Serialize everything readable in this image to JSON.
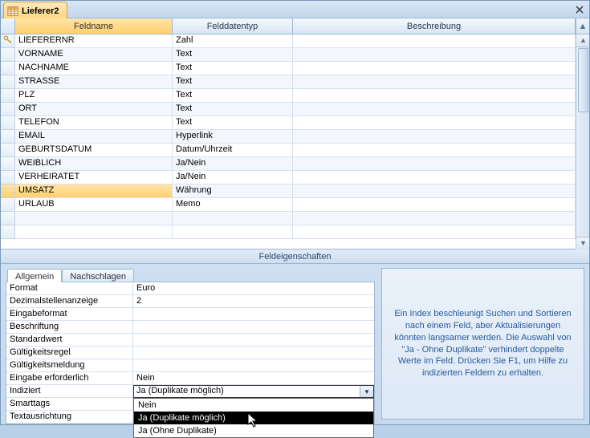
{
  "tab_title": "Lieferer2",
  "columns": {
    "field": "Feldname",
    "dtype": "Felddatentyp",
    "desc": "Beschreibung"
  },
  "fields": [
    {
      "name": "LIEFERERNR",
      "type": "Zahl",
      "pk": true
    },
    {
      "name": "VORNAME",
      "type": "Text"
    },
    {
      "name": "NACHNAME",
      "type": "Text"
    },
    {
      "name": "STRASSE",
      "type": "Text"
    },
    {
      "name": "PLZ",
      "type": "Text"
    },
    {
      "name": "ORT",
      "type": "Text"
    },
    {
      "name": "TELEFON",
      "type": "Text"
    },
    {
      "name": "EMAIL",
      "type": "Hyperlink"
    },
    {
      "name": "GEBURTSDATUM",
      "type": "Datum/Uhrzeit"
    },
    {
      "name": "WEIBLICH",
      "type": "Ja/Nein"
    },
    {
      "name": "VERHEIRATET",
      "type": "Ja/Nein"
    },
    {
      "name": "UMSATZ",
      "type": "Währung",
      "selected": true
    },
    {
      "name": "URLAUB",
      "type": "Memo"
    }
  ],
  "props_title": "Feldeigenschaften",
  "prop_tabs": {
    "general": "Allgemein",
    "lookup": "Nachschlagen"
  },
  "properties": [
    {
      "label": "Format",
      "value": "Euro"
    },
    {
      "label": "Dezimalstellenanzeige",
      "value": "2"
    },
    {
      "label": "Eingabeformat",
      "value": ""
    },
    {
      "label": "Beschriftung",
      "value": ""
    },
    {
      "label": "Standardwert",
      "value": ""
    },
    {
      "label": "Gültigkeitsregel",
      "value": ""
    },
    {
      "label": "Gültigkeitsmeldung",
      "value": ""
    },
    {
      "label": "Eingabe erforderlich",
      "value": "Nein"
    },
    {
      "label": "Indiziert",
      "value": "Ja (Duplikate möglich)",
      "editing": true,
      "dropdown": true
    },
    {
      "label": "Smarttags",
      "value": ""
    },
    {
      "label": "Textausrichtung",
      "value": ""
    }
  ],
  "dropdown_options": [
    {
      "label": "Nein"
    },
    {
      "label": "Ja (Duplikate möglich)",
      "hover": true
    },
    {
      "label": "Ja (Ohne Duplikate)"
    }
  ],
  "help_text": "Ein Index beschleunigt Suchen und Sortieren nach einem Feld, aber Aktualisierungen könnten langsamer werden.  Die Auswahl von \"Ja - Ohne Duplikate\" verhindert doppelte Werte im Feld. Drücken Sie F1, um Hilfe zu indizierten Feldern zu erhalten."
}
